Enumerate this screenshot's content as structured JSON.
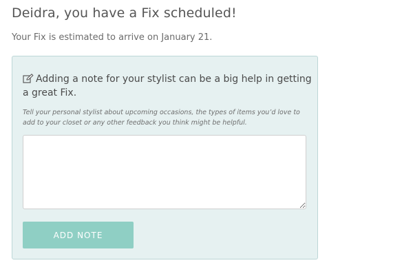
{
  "header": {
    "title": "Deidra, you have a Fix scheduled!",
    "subtitle": "Your Fix is estimated to arrive on January 21."
  },
  "note_panel": {
    "icon": "edit-note-icon",
    "heading": "Adding a note for your stylist can be a big help in getting a great Fix.",
    "help_text": "Tell your personal stylist about upcoming occasions, the types of items you’d love to add to your closet or any other feedback you think might be helpful.",
    "textarea_value": "",
    "button_label": "ADD NOTE"
  },
  "colors": {
    "panel_background": "#e6f1f1",
    "panel_border": "#bcd6d6",
    "button_background": "#8fcfc4",
    "button_text": "#ffffff"
  }
}
